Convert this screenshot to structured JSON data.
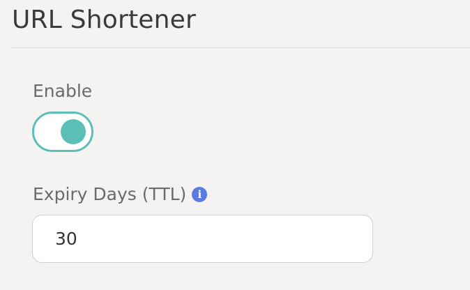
{
  "page": {
    "title": "URL Shortener"
  },
  "enable": {
    "label": "Enable",
    "checked": true,
    "accent_color": "#5bbfb8"
  },
  "expiry": {
    "label": "Expiry Days (TTL)",
    "info_icon": "info-circle-icon",
    "info_icon_glyph": "i",
    "info_color": "#5b7be0",
    "value": "30"
  }
}
